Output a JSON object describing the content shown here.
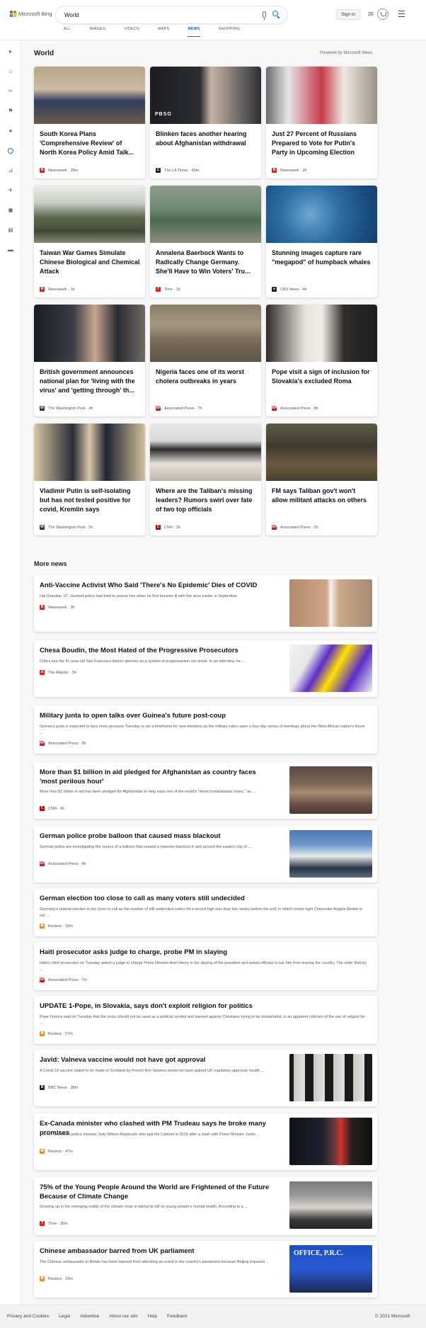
{
  "header": {
    "brand": "Microsoft Bing",
    "search_value": "World",
    "sign_in": "Sign in",
    "rewards_count": "20",
    "tabs": [
      "ALL",
      "IMAGES",
      "VIDEOS",
      "MAPS",
      "NEWS",
      "SHOPPING"
    ],
    "active_tab": "NEWS"
  },
  "colors": {
    "accent": "#1a73c8",
    "tab_active": "#1a5fb4"
  },
  "sidebar": {
    "icons": [
      "expand-icon",
      "home-icon",
      "tools-icon",
      "flag-icon",
      "location-icon",
      "globe-icon",
      "chart-icon",
      "rocket-icon",
      "film-icon",
      "briefcase-icon",
      "car-icon"
    ]
  },
  "section": {
    "title": "World",
    "powered_by": "Powered by Microsoft News"
  },
  "cards": [
    {
      "title": "South Korea Plans 'Comprehensive Review' of North Korea Policy Amid Talk...",
      "source": "Newsweek",
      "time": "28m",
      "logo": "N",
      "logo_color": "#e2241a"
    },
    {
      "title": "Blinken faces another hearing about Afghanistan withdrawal",
      "source": "The LA Times",
      "time": "49m",
      "logo": "C",
      "logo_color": "#222222",
      "image_caption": "PBSO"
    },
    {
      "title": "Just 27 Percent of Russians Prepared to Vote for Putin's Party in Upcoming Election",
      "source": "Newsweek",
      "time": "2h",
      "logo": "N",
      "logo_color": "#e2241a"
    },
    {
      "title": "Taiwan War Games Simulate Chinese Biological and Chemical Attack",
      "source": "Newsweek",
      "time": "1h",
      "logo": "N",
      "logo_color": "#e2241a"
    },
    {
      "title": "Annalena Baerbock Wants to Radically Change Germany. She'll Have to Win Voters' Tru...",
      "source": "Time",
      "time": "1h",
      "logo": "T",
      "logo_color": "#e2241a"
    },
    {
      "title": "Stunning images capture rare \"megapod\" of humpback whales",
      "source": "CBS News",
      "time": "4h",
      "logo": "●",
      "logo_color": "#222222"
    },
    {
      "title": "British government announces national plan for 'living with the virus' and 'getting through' th...",
      "source": "The Washington Post",
      "time": "4h",
      "logo": "W",
      "logo_color": "#333333"
    },
    {
      "title": "Nigeria faces one of its worst cholera outbreaks in years",
      "source": "Associated Press",
      "time": "7h",
      "logo": "AP",
      "logo_color": "#d71920"
    },
    {
      "title": "Pope visit a sign of inclusion for Slovakia's excluded Roma",
      "source": "Associated Press",
      "time": "8h",
      "logo": "AP",
      "logo_color": "#d71920"
    },
    {
      "title": "Vladimir Putin is self-isolating but has not tested positive for covid, Kremlin says",
      "source": "The Washington Post",
      "time": "5h",
      "logo": "W",
      "logo_color": "#333333"
    },
    {
      "title": "Where are the Taliban's missing leaders? Rumors swirl over fate of two top officials",
      "source": "CNN",
      "time": "2h",
      "logo": "C",
      "logo_color": "#cc0000"
    },
    {
      "title": "FM says Taliban gov't won't allow militant attacks on others",
      "source": "Associated Press",
      "time": "2h",
      "logo": "AP",
      "logo_color": "#d71920"
    }
  ],
  "more_news": {
    "title": "More news",
    "items": [
      {
        "title": "Anti-Vaccine Activist Who Said 'There's No Epidemic' Dies of COVID",
        "snippet": "Hai Shaulian, 57, claimed police had tried to poison him when he first became ill with the virus earlier in September.",
        "source": "Newsweek",
        "time": "3h",
        "logo": "N",
        "logo_color": "#e2241a"
      },
      {
        "title": "Chesa Boudin, the Most Hated of the Progressive Prosecutors",
        "snippet": "Critics see the 41-year-old San Francisco district attorney as a symbol of progressivism run amok. In an interview, he ...",
        "source": "The Atlantic",
        "time": "3h",
        "logo": "A",
        "logo_color": "#e2241a"
      },
      {
        "title": "Military junta to open talks over Guinea's future post-coup",
        "snippet": "Guinea's junta is expected to face more pressure Tuesday to set a timeframe for new elections as the military rulers open a four-day series of meetings about the West African nation's future ...",
        "source": "Associated Press",
        "time": "9h",
        "logo": "AP",
        "logo_color": "#d71920"
      },
      {
        "title": "More than $1 billion in aid pledged for Afghanistan as country faces 'most perilous hour'",
        "snippet": "More than $1 billion in aid has been pledged for Afghanistan to help ease one of the world's \"worst humanitarian crises,\" as ...",
        "source": "CNN",
        "time": "9h",
        "logo": "C",
        "logo_color": "#cc0000"
      },
      {
        "title": "German police probe balloon that caused mass blackout",
        "snippet": "German police are investigating the source of a balloon that caused a massive blackout in and around the eastern city of ...",
        "source": "Associated Press",
        "time": "4h",
        "logo": "AP",
        "logo_color": "#d71920"
      },
      {
        "title": "German election too close to call as many voters still undecided",
        "snippet": "Germany's federal election is too close to call as the number of still undecided voters hit a record high less than two weeks before the poll, in which center-right Chancellor Angela Merkel is not ...",
        "source": "Reuters",
        "time": "32m",
        "logo": "✺",
        "logo_color": "#f08a24"
      },
      {
        "title": "Haiti prosecutor asks judge to charge, probe PM in slaying",
        "snippet": "Haiti's chief prosecutor on Tuesday asked a judge to charge Prime Minister Ariel Henry in the slaying of the president and asked officials to bar him from leaving the country. The order filed by ...",
        "source": "Associated Press",
        "time": "7m",
        "logo": "AP",
        "logo_color": "#d71920"
      },
      {
        "title": "UPDATE 1-Pope, in Slovakia, says don't exploit religion for politics",
        "snippet": "Pope Francis said on Tuesday that the cross should not be used as a political symbol and warned against Christians trying to be triumphalist, in an apparent criticism of the use of religion for ...",
        "source": "Reuters",
        "time": "57m",
        "logo": "✺",
        "logo_color": "#f08a24"
      },
      {
        "title": "Javid: Valneva vaccine would not have got approval",
        "snippet": "A Covid-19 vaccine slated to be made in Scotland by French firm Valneva would not have gained UK regulatory approval, health ...",
        "source": "BBC News",
        "time": "38m",
        "logo": "B",
        "logo_color": "#222222"
      },
      {
        "title": "Ex-Canada minister who clashed with PM Trudeau says he broke many promises",
        "snippet": "Former Canadian justice minister Jody Wilson-Raybould, who quit the Cabinet in 2019 after a clash with Prime Minister Justin ...",
        "source": "Reuters",
        "time": "47m",
        "logo": "✺",
        "logo_color": "#f08a24"
      },
      {
        "title": "75% of the Young People Around the World are Frightened of the Future Because of Climate Change",
        "snippet": "Growing up in the emerging reality of the climate crisis is taking its toll on young people's mental health. According to a ...",
        "source": "Time",
        "time": "36m",
        "logo": "T",
        "logo_color": "#e2241a"
      },
      {
        "title": "Chinese ambassador barred from UK parliament",
        "snippet": "The Chinese ambassador to Britain has been banned from attending an event in the country's parliament because Beijing imposed ...",
        "source": "Reuters",
        "time": "15m",
        "logo": "✺",
        "logo_color": "#f08a24",
        "image_caption": "OFFICE, P.R.C."
      }
    ]
  },
  "footer": {
    "links": [
      "Privacy and Cookies",
      "Legal",
      "Advertise",
      "About our ads",
      "Help",
      "Feedback"
    ],
    "copyright": "© 2021 Microsoft"
  }
}
